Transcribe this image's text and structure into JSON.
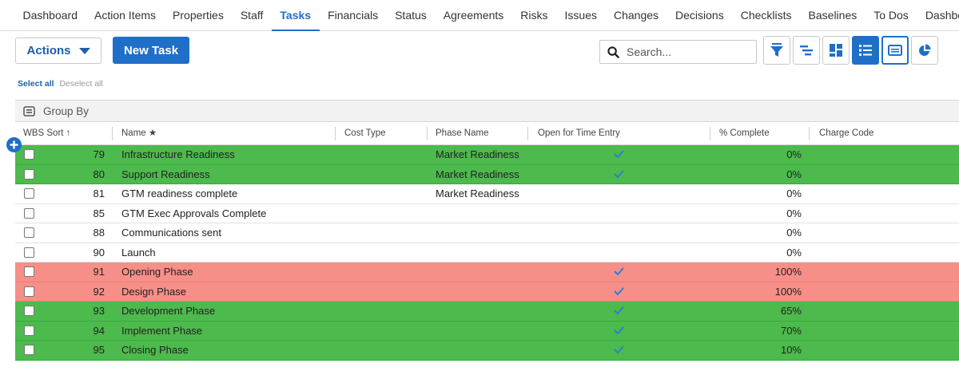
{
  "nav": {
    "tabs": [
      "Dashboard",
      "Action Items",
      "Properties",
      "Staff",
      "Tasks",
      "Financials",
      "Status",
      "Agreements",
      "Risks",
      "Issues",
      "Changes",
      "Decisions",
      "Checklists",
      "Baselines",
      "To Dos",
      "Dashboard"
    ],
    "active_index": 4
  },
  "toolbar": {
    "actions_label": "Actions",
    "new_task_label": "New Task",
    "search_placeholder": "Search..."
  },
  "selection": {
    "select_all": "Select all",
    "deselect_all": "Deselect all"
  },
  "group_by_label": "Group By",
  "columns": {
    "wbs_sort": "WBS Sort ↑",
    "name": "Name ★",
    "cost_type": "Cost Type",
    "phase_name": "Phase Name",
    "open_for_time_entry": "Open for Time Entry",
    "pct_complete": "% Complete",
    "charge_code": "Charge Code"
  },
  "colors": {
    "accent": "#1f6fc9",
    "row_green": "#4cba4c",
    "row_red": "#f68f88",
    "check": "#2a7fd4"
  },
  "rows": [
    {
      "wbs": "79",
      "name": "Infrastructure Readiness",
      "phase": "Market Readiness",
      "open": true,
      "pct": "0%",
      "status": "green"
    },
    {
      "wbs": "80",
      "name": "Support Readiness",
      "phase": "Market Readiness",
      "open": true,
      "pct": "0%",
      "status": "green"
    },
    {
      "wbs": "81",
      "name": "GTM readiness complete",
      "phase": "Market Readiness",
      "open": false,
      "pct": "0%",
      "status": "none"
    },
    {
      "wbs": "85",
      "name": "GTM Exec Approvals Complete",
      "phase": "",
      "open": false,
      "pct": "0%",
      "status": "none"
    },
    {
      "wbs": "88",
      "name": "Communications sent",
      "phase": "",
      "open": false,
      "pct": "0%",
      "status": "none"
    },
    {
      "wbs": "90",
      "name": "Launch",
      "phase": "",
      "open": false,
      "pct": "0%",
      "status": "none"
    },
    {
      "wbs": "91",
      "name": "Opening Phase",
      "phase": "",
      "open": true,
      "pct": "100%",
      "status": "red"
    },
    {
      "wbs": "92",
      "name": "Design Phase",
      "phase": "",
      "open": true,
      "pct": "100%",
      "status": "red"
    },
    {
      "wbs": "93",
      "name": "Development Phase",
      "phase": "",
      "open": true,
      "pct": "65%",
      "status": "green"
    },
    {
      "wbs": "94",
      "name": "Implement Phase",
      "phase": "",
      "open": true,
      "pct": "70%",
      "status": "green"
    },
    {
      "wbs": "95",
      "name": "Closing Phase",
      "phase": "",
      "open": true,
      "pct": "10%",
      "status": "green"
    }
  ]
}
